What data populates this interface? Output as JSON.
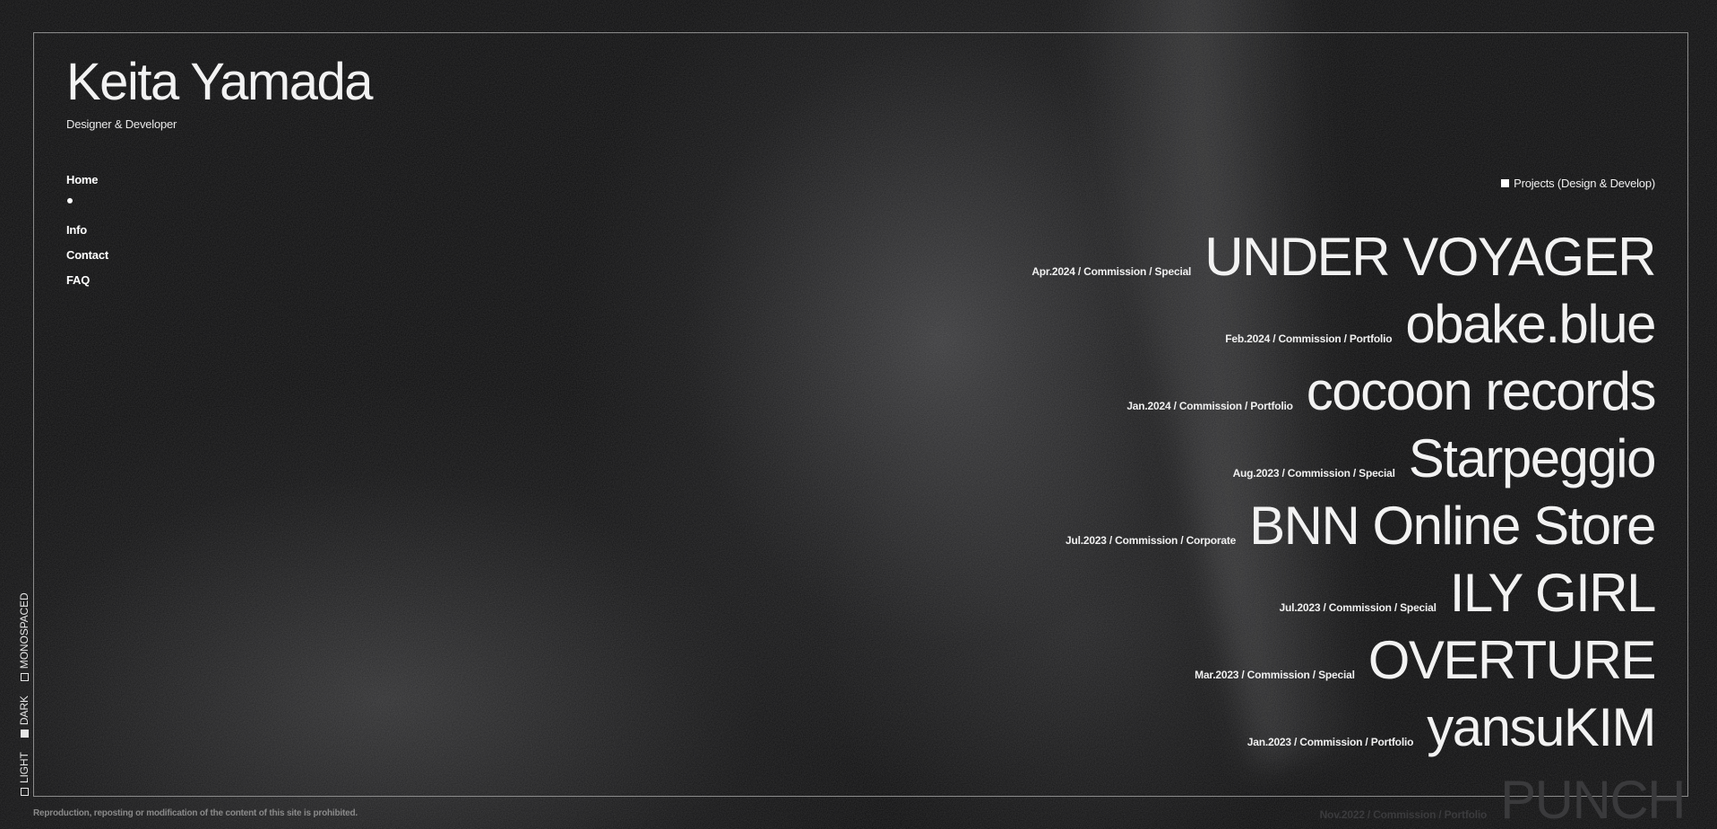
{
  "brand": {
    "name": "Keita Yamada",
    "subtitle": "Designer & Developer"
  },
  "nav": {
    "home": "Home",
    "info": "Info",
    "contact": "Contact",
    "faq": "FAQ"
  },
  "projects_heading": "Projects (Design & Develop)",
  "projects": [
    {
      "meta": "Apr.2024 / Commission / Special",
      "title": "UNDER VOYAGER"
    },
    {
      "meta": "Feb.2024 / Commission / Portfolio",
      "title": "obake.blue"
    },
    {
      "meta": "Jan.2024 / Commission / Portfolio",
      "title": "cocoon records"
    },
    {
      "meta": "Aug.2023 / Commission / Special",
      "title": "Starpeggio"
    },
    {
      "meta": "Jul.2023 / Commission / Corporate",
      "title": "BNN Online Store"
    },
    {
      "meta": "Jul.2023 / Commission / Special",
      "title": "ILY GIRL"
    },
    {
      "meta": "Mar.2023 / Commission / Special",
      "title": "OVERTURE"
    },
    {
      "meta": "Jan.2023 / Commission / Portfolio",
      "title": "yansuKIM"
    },
    {
      "meta": "Nov.2022 / Commission / Portfolio",
      "title": "PUNCH"
    }
  ],
  "themes": {
    "light": "LIGHT",
    "dark": "DARK",
    "monospaced": "MONOSPACED",
    "selected": "DARK"
  },
  "footer": {
    "notice": "Reproduction, reposting or modification of the content of this site is prohibited."
  },
  "colors": {
    "background": "#0d0d0e",
    "text": "#ffffff",
    "frame": "#8c8c8c",
    "muted": "#8a8a8a"
  }
}
